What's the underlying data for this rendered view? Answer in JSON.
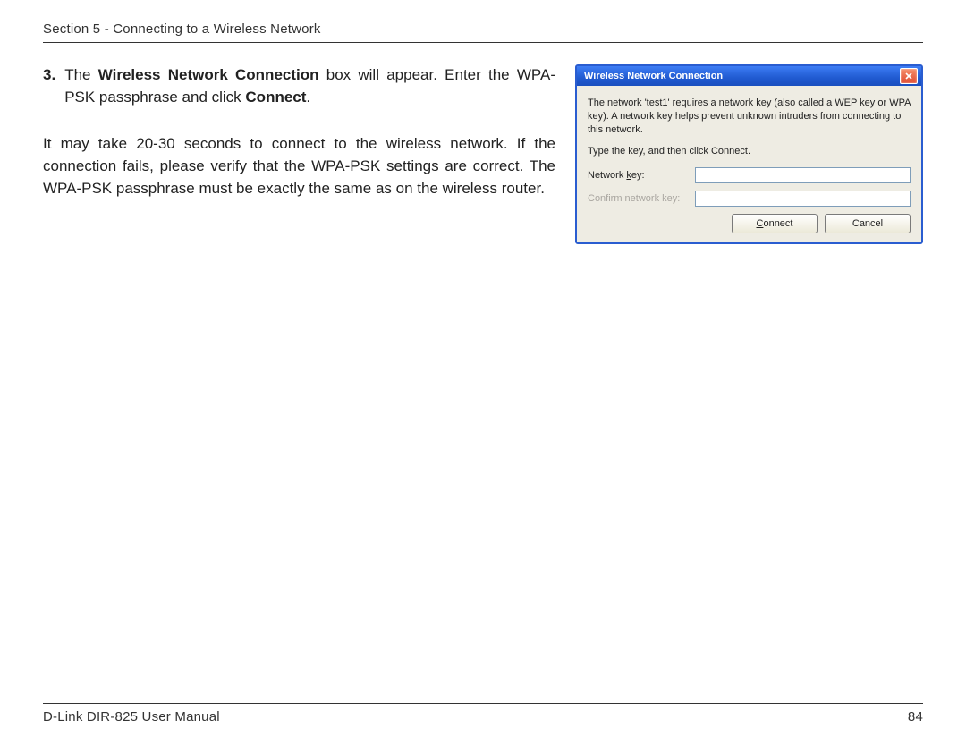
{
  "header": {
    "section_title": "Section 5 - Connecting to a Wireless Network"
  },
  "body": {
    "step_number": "3.",
    "step_line1_pre": "The ",
    "step_line1_bold1": "Wireless Network Connection",
    "step_line1_mid": " box will appear. Enter the WPA-PSK passphrase and click ",
    "step_line1_bold2": "Connect",
    "step_line1_post": ".",
    "para2": "It may take 20-30 seconds to connect to the wireless network. If the connection fails, please verify that the WPA-PSK settings are correct. The WPA-PSK passphrase must be exactly the same as on the wireless router."
  },
  "dialog": {
    "title": "Wireless Network Connection",
    "close_icon": "close",
    "description": "The network 'test1' requires a network key (also called a WEP key or WPA key). A network key helps prevent unknown intruders from connecting to this network.",
    "instruction": "Type the key, and then click Connect.",
    "network_key_label": "Network key:",
    "network_key_label_underline_char": "k",
    "confirm_key_label": "Confirm network key:",
    "network_key_value": "",
    "confirm_key_value": "",
    "connect_btn": "Connect",
    "connect_btn_underline_char": "C",
    "cancel_btn": "Cancel"
  },
  "footer": {
    "manual": "D-Link DIR-825 User Manual",
    "page": "84"
  }
}
